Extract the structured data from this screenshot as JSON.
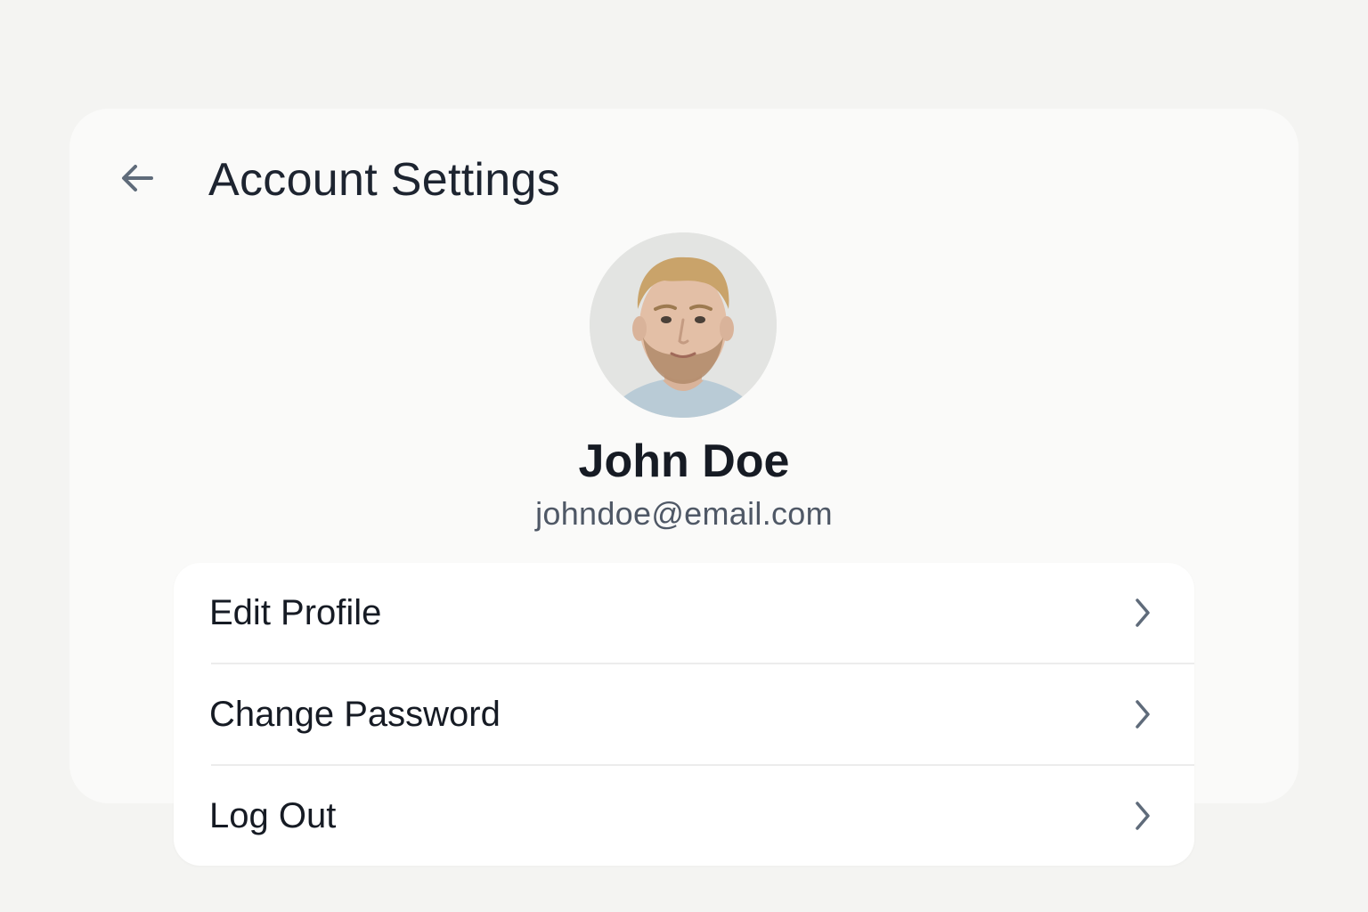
{
  "header": {
    "back_icon": "arrow-left-icon",
    "title": "Account Settings"
  },
  "profile": {
    "avatar_alt": "profile-photo",
    "name": "John Doe",
    "email": "johndoe@email.com"
  },
  "menu": {
    "items": [
      {
        "label": "Edit Profile",
        "icon": "chevron-right-icon"
      },
      {
        "label": "Change Password",
        "icon": "chevron-right-icon"
      },
      {
        "label": "Log Out",
        "icon": "chevron-right-icon"
      }
    ]
  },
  "colors": {
    "background": "#f4f4f2",
    "card": "#fafaf9",
    "menu_card": "#ffffff",
    "text_primary": "#161b24",
    "text_secondary": "#4f5866",
    "icon": "#5f6b7a"
  }
}
